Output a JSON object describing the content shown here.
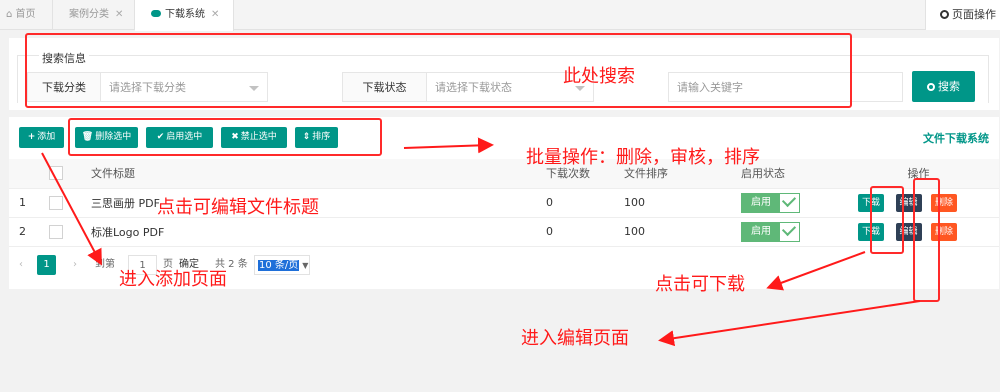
{
  "tabs": {
    "home": "首页",
    "case": "案例分类",
    "download": "下载系统",
    "page_ops": "页面操作"
  },
  "search": {
    "legend": "搜索信息",
    "category_label": "下载分类",
    "category_placeholder": "请选择下载分类",
    "status_label": "下载状态",
    "status_placeholder": "请选择下载状态",
    "keyword_placeholder": "请输入关键字",
    "search_button": "搜索"
  },
  "toolbar": {
    "add": "添加",
    "delete_selected": "删除选中",
    "enable_selected": "启用选中",
    "disable_selected": "禁止选中",
    "sort": "排序",
    "system_title": "文件下载系统"
  },
  "table": {
    "headers": {
      "title": "文件标题",
      "downloads": "下载次数",
      "order": "文件排序",
      "status": "启用状态",
      "actions": "操作"
    },
    "rows": [
      {
        "index": "1",
        "title": "三思画册 PDF",
        "downloads": "0",
        "order": "100",
        "status": "启用"
      },
      {
        "index": "2",
        "title": "标准Logo PDF",
        "downloads": "0",
        "order": "100",
        "status": "启用"
      }
    ],
    "action_labels": {
      "download": "下载",
      "edit": "编辑",
      "delete": "删除"
    }
  },
  "pager": {
    "prev": "‹",
    "current": "1",
    "next": "›",
    "goto_prefix": "到第",
    "goto_value": "1",
    "page_unit": "页",
    "confirm": "确定",
    "total": "共 2 条",
    "page_size": "10 条/页"
  },
  "annotations": {
    "search_here": "此处搜索",
    "batch_ops": "批量操作：删除，审核，排序",
    "edit_title": "点击可编辑文件标题",
    "enter_add": "进入添加页面",
    "click_download": "点击可下载",
    "enter_edit": "进入编辑页面",
    "color": "#ff1a1a"
  }
}
